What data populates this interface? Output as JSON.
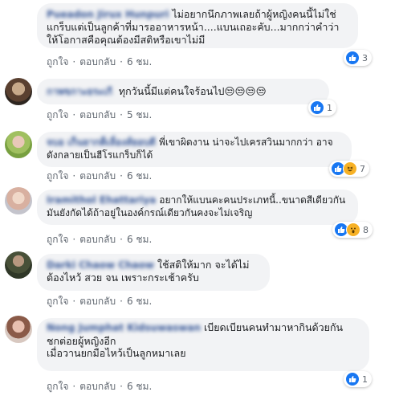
{
  "common": {
    "like": "ถูกใจ",
    "reply": "ตอบกลับ",
    "dot": "·"
  },
  "comments": [
    {
      "name": "Pueadon Jirux Hunpuri",
      "text": "ไม่อยากนึกภาพเลยถ้าผู้หญิงคนนี้ไม่ใช่แกร็บแต่เป็นลูกค้าที่มารออาหารหน้า....แบนเถอะคับ...มากกว่าคำว่าให้โอกาสคือคุณต้องมีสติหรือเขาไม่มี",
      "time": "6 ชม.",
      "reactions": [
        "like"
      ],
      "count": "3"
    },
    {
      "name": "กาพขกาะยระเกื",
      "text": "ทุกวันนี้มีแต่คนใจร้อนไป😒😒😒😒",
      "time": "5 ชม.",
      "reactions": [
        "like"
      ],
      "count": "1"
    },
    {
      "name": "จบอ เก็นยากต็เลื่องส์ยอบดี",
      "text": "พี่เขาผิดงาน น่าจะไปเครสวินมากกว่า อาจดังกลายเป็นฮีโรแกร็บก็ได้",
      "time": "6 ชม.",
      "reactions": [
        "like",
        "haha"
      ],
      "count": "7"
    },
    {
      "name": "Iramithol Ehattariya",
      "text": "อยากให้แบนคะคนประเภทนี้..ขนาดสีเดียวกันมันยังกัดได้ถ้าอยู่ในองค์กรณ์เดียวกันคงจะไม่เจริญ",
      "time": "6 ชม.",
      "reactions": [
        "like",
        "wow"
      ],
      "count": "8"
    },
    {
      "name": "Darki Chaow Chaow",
      "text": "ใช้สติให้มาก จะได้ไม่ต้องไหว้ สวย จน เพราะกระเช้าครับ",
      "time": "6 ชม.",
      "reactions": [],
      "count": ""
    },
    {
      "name": "Nong Jumphat Kidsuwaswan",
      "text": "เบียดเบียนคนทำมาหากินด้วยกัน\nชกต่อยผู้หญิงอีก\nเมื่อวานยกมือไหว้เป็นลูกหมาเลย",
      "time": "6 ชม.",
      "reactions": [
        "like"
      ],
      "count": "1"
    }
  ],
  "colors": {
    "bubble": "#f2f3f5",
    "name": "#385898",
    "action": "#606770",
    "like": "#1877f2",
    "haha": "#f7b125"
  }
}
